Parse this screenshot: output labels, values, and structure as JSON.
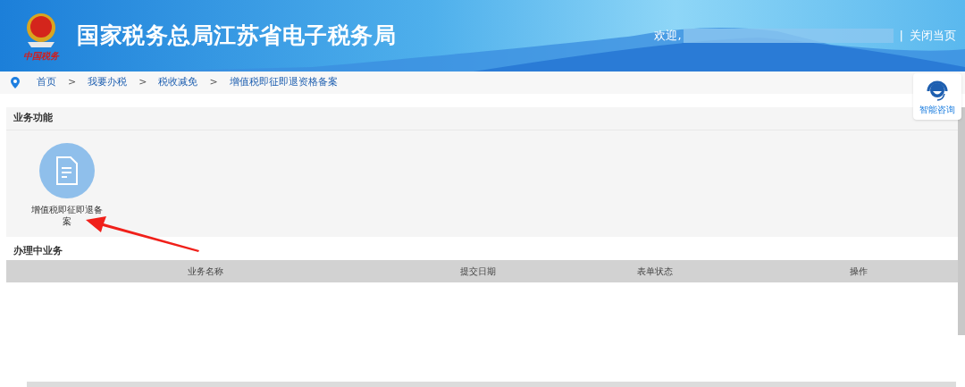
{
  "header": {
    "emblem_caption": "中国税务",
    "title": "国家税务总局江苏省电子税务局",
    "welcome": "欢迎,",
    "divider": "|",
    "close_link": "关闭当页"
  },
  "breadcrumb": [
    "首页",
    "我要办税",
    "税收减免",
    "增值税即征即退资格备案"
  ],
  "breadcrumb_separator": ">",
  "consult": {
    "label": "智能咨询"
  },
  "functions": {
    "title": "业务功能",
    "items": [
      {
        "label": "增值税即征即退备案"
      }
    ]
  },
  "in_progress": {
    "title": "办理中业务",
    "columns": [
      "业务名称",
      "提交日期",
      "表单状态",
      "操作"
    ]
  }
}
